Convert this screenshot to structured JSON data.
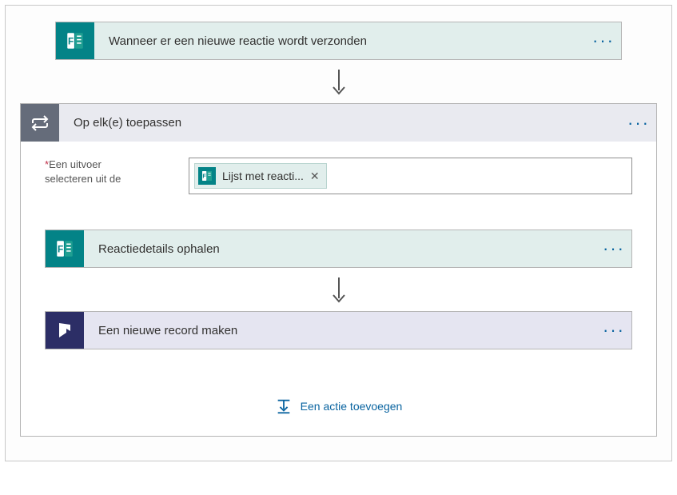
{
  "trigger": {
    "title": "Wanneer er een nieuwe reactie wordt verzonden"
  },
  "foreach": {
    "title": "Op elk(e) toepassen",
    "input_label_line1": "Een uitvoer",
    "input_label_line2": "selecteren uit de",
    "token_label": "Lijst met reacti...",
    "add_action_label": "Een actie toevoegen"
  },
  "step_details": {
    "title": "Reactiedetails ophalen"
  },
  "step_record": {
    "title": "Een nieuwe record maken"
  },
  "glyphs": {
    "more": "···",
    "close": "✕"
  }
}
